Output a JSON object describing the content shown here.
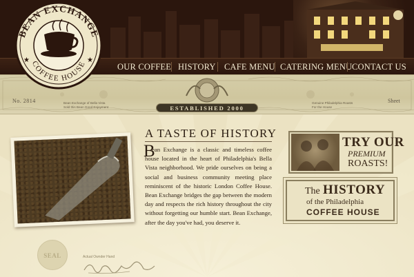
{
  "brand": {
    "name_top": "BEAN EXCHANGE",
    "name_bottom": "COFFEE HOUSE"
  },
  "nav": {
    "items": [
      {
        "label": "OUR COFFEE"
      },
      {
        "label": "HISTORY"
      },
      {
        "label": "CAFE MENU"
      },
      {
        "label": "CATERING MENU"
      },
      {
        "label": "CONTACT US"
      }
    ]
  },
  "band": {
    "number": "No. 2814",
    "established": "ESTABLISHED 2000",
    "right_label": "Sheet",
    "left_small_1": "Bean Exchange of Bella Vista",
    "left_small_2": "Sold this Bean   Good Enjoyment",
    "right_small_1": "Genuine Philadelphia Roasts",
    "right_small_2": "For the House"
  },
  "main": {
    "title": "A TASTE OF HISTORY",
    "dropcap": "B",
    "body": "ean Exchange is a classic and timeless coffee house located in the heart of Philadelphia's Bella Vista neighborhood. We pride ourselves on being a social and business community meeting place reminiscent of the historic London Coffee House. Bean Exchange bridges the gap between the modern day and respects the rich history throughout the city without forgetting our humble start. Bean Exchange, after the day you've had, you deserve it."
  },
  "sidebar": {
    "roasts": {
      "line1": "TRY OUR",
      "line2": "PREMIUM",
      "line3": "ROASTS!"
    },
    "history": {
      "the": "The",
      "history": "HISTORY",
      "of": "of the Philadelphia",
      "coffee": "COFFEE HOUSE"
    }
  },
  "footer": {
    "seal": "SEAL",
    "signature_label": "Actual Ownder Hand"
  },
  "colors": {
    "header_bg": "#2b160d",
    "page_bg": "#efe7c9",
    "nav_text": "#f3ead0",
    "ink": "#2b1d12"
  }
}
